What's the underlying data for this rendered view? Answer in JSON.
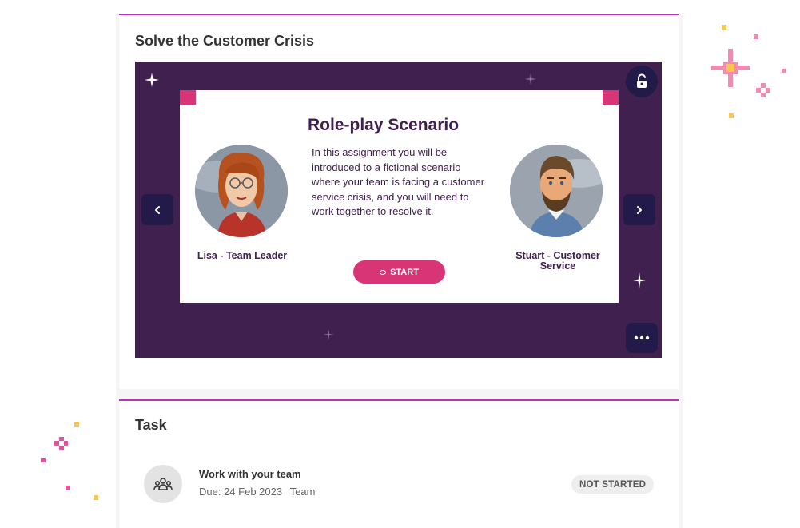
{
  "colors": {
    "accent_line": "#c02fc4",
    "stage_bg": "#40204f",
    "button_dark": "#221a48",
    "start_pink": "#d83577"
  },
  "card1": {
    "title": "Solve the Customer Crisis",
    "slide": {
      "title": "Role-play Scenario",
      "body": "In this assignment you will be introduced to a fictional scenario where your team is facing a customer service crisis, and you will need to work together to resolve it.",
      "start_label": "START",
      "left_character": {
        "name": "Lisa - Team Leader"
      },
      "right_character": {
        "name": "Stuart - Customer Service"
      }
    },
    "controls": {
      "prev_icon": "chevron-left-icon",
      "next_icon": "chevron-right-icon",
      "lock_icon": "unlock-icon",
      "more_icon": "more-horizontal-icon"
    }
  },
  "card2": {
    "title": "Task",
    "task": {
      "icon": "team-icon",
      "name": "Work with your team",
      "due": "Due: 24 Feb 2023",
      "type": "Team",
      "status": "NOT STARTED"
    }
  }
}
